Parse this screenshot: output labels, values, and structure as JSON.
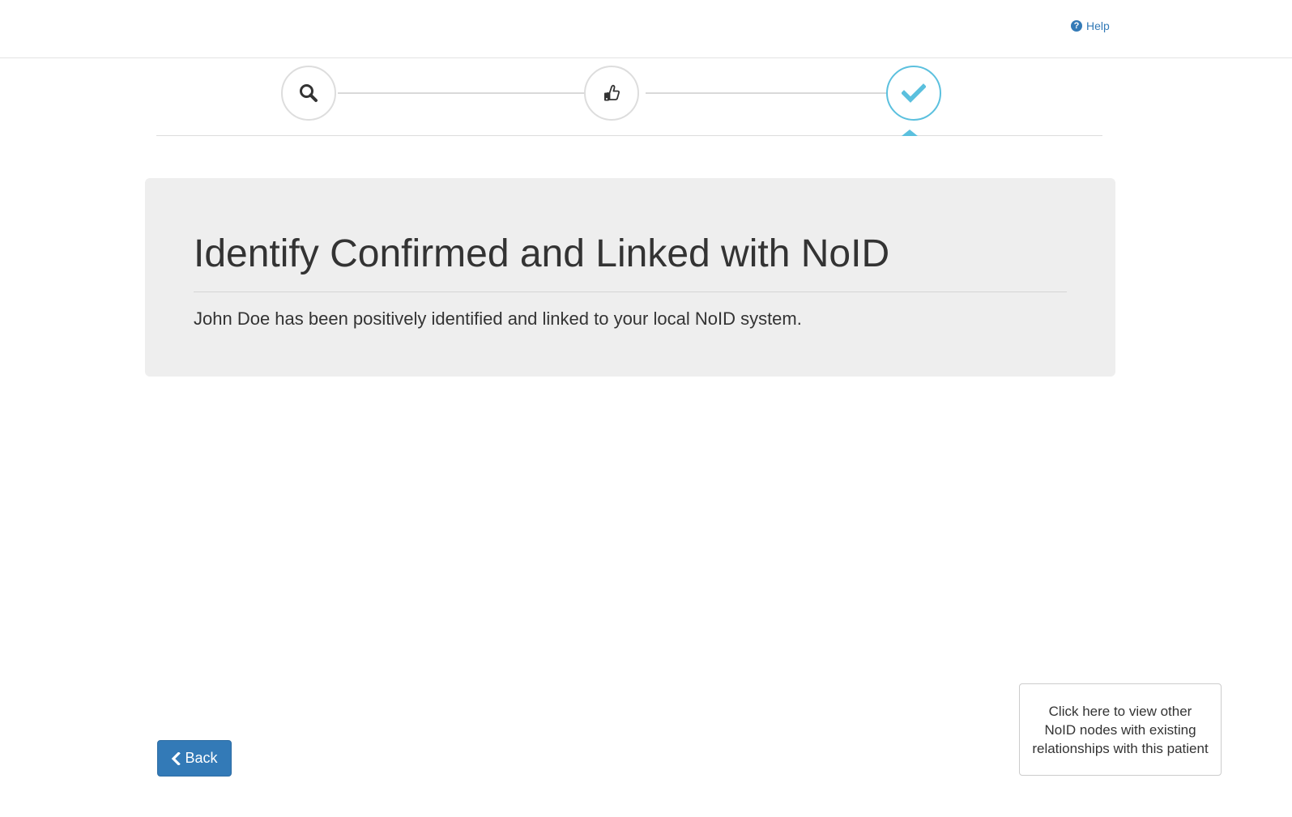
{
  "header": {
    "help_label": "Help",
    "help_icon": "question-circle-icon"
  },
  "stepper": {
    "steps": [
      {
        "icon": "search-icon",
        "state": "complete"
      },
      {
        "icon": "thumbs-up-icon",
        "state": "complete"
      },
      {
        "icon": "checkmark-icon",
        "state": "active"
      }
    ],
    "active_color": "#5bc0de"
  },
  "panel": {
    "title": "Identify Confirmed and Linked with NoID",
    "message": "John Doe has been positively identified and linked to your local NoID system."
  },
  "footer": {
    "back_label": "Back",
    "back_icon": "chevron-left-icon",
    "relationships_text": "Click here to view other NoID nodes with existing relationships with this patient"
  },
  "colors": {
    "primary": "#337ab7",
    "info": "#5bc0de",
    "panel_bg": "#eeeeee"
  }
}
